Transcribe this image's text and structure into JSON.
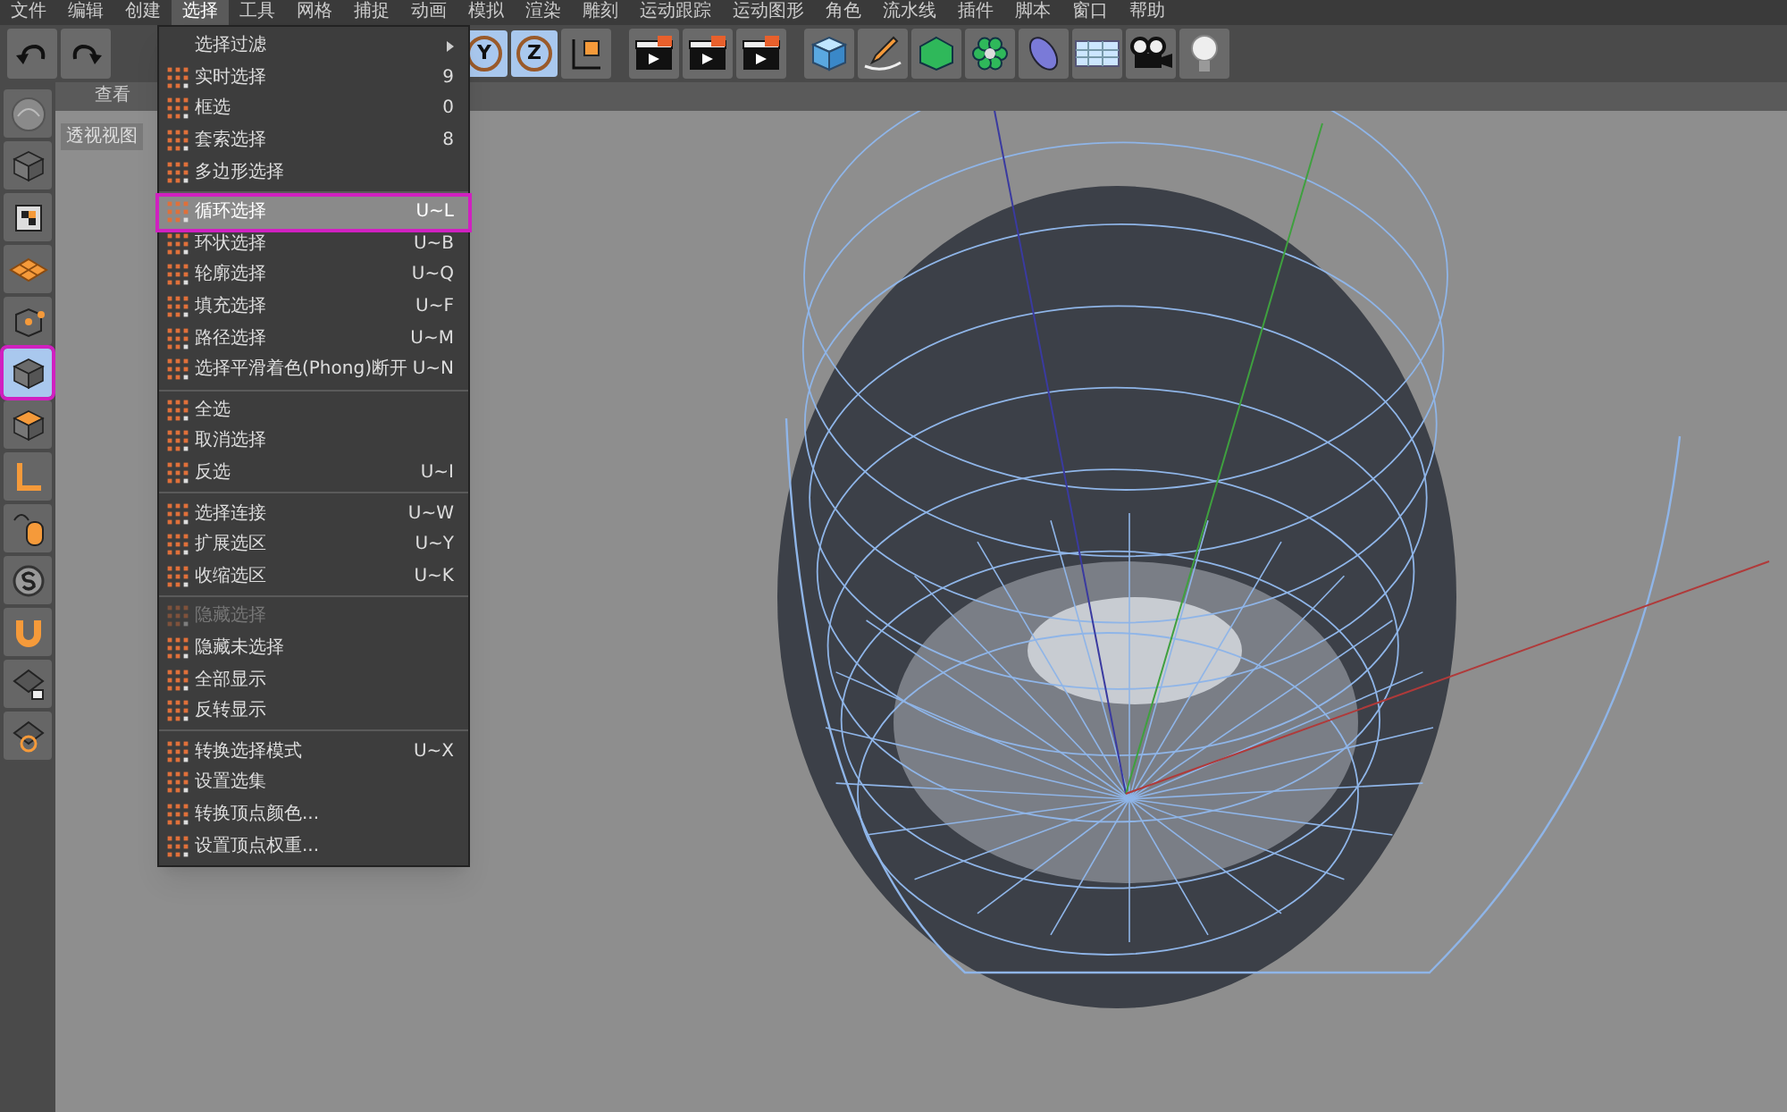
{
  "menubar": [
    {
      "label": "文件",
      "selected": false
    },
    {
      "label": "编辑",
      "selected": false
    },
    {
      "label": "创建",
      "selected": false
    },
    {
      "label": "选择",
      "selected": true
    },
    {
      "label": "工具",
      "selected": false
    },
    {
      "label": "网格",
      "selected": false
    },
    {
      "label": "捕捉",
      "selected": false
    },
    {
      "label": "动画",
      "selected": false
    },
    {
      "label": "模拟",
      "selected": false
    },
    {
      "label": "渲染",
      "selected": false
    },
    {
      "label": "雕刻",
      "selected": false
    },
    {
      "label": "运动跟踪",
      "selected": false
    },
    {
      "label": "运动图形",
      "selected": false
    },
    {
      "label": "角色",
      "selected": false
    },
    {
      "label": "流水线",
      "selected": false
    },
    {
      "label": "插件",
      "selected": false
    },
    {
      "label": "脚本",
      "selected": false
    },
    {
      "label": "窗口",
      "selected": false
    },
    {
      "label": "帮助",
      "selected": false
    }
  ],
  "toolbar": [
    {
      "kind": "undo"
    },
    {
      "kind": "redo"
    },
    {
      "kind": "wide_gap"
    },
    {
      "kind": "axis",
      "label": "Y"
    },
    {
      "kind": "axis",
      "label": "Z"
    },
    {
      "kind": "coords"
    },
    {
      "kind": "gap"
    },
    {
      "kind": "clapper"
    },
    {
      "kind": "clapper"
    },
    {
      "kind": "clapper"
    },
    {
      "kind": "gap"
    },
    {
      "kind": "cube"
    },
    {
      "kind": "pen"
    },
    {
      "kind": "gem"
    },
    {
      "kind": "flower"
    },
    {
      "kind": "capsule"
    },
    {
      "kind": "floor"
    },
    {
      "kind": "camera"
    },
    {
      "kind": "bulb"
    }
  ],
  "viewport": {
    "tabs": [
      "查看"
    ],
    "title": "透视视图"
  },
  "side_tools": [
    {
      "kind": "sculpt",
      "selected": false
    },
    {
      "kind": "cube",
      "selected": false
    },
    {
      "kind": "checker",
      "selected": false
    },
    {
      "kind": "plane",
      "selected": false
    },
    {
      "kind": "points",
      "selected": false
    },
    {
      "kind": "cube",
      "selected": true
    },
    {
      "kind": "topcube",
      "selected": false
    },
    {
      "kind": "corner",
      "selected": false
    },
    {
      "kind": "mouse",
      "selected": false
    },
    {
      "kind": "coin",
      "selected": false
    },
    {
      "kind": "magnet",
      "selected": false
    },
    {
      "kind": "lockgrid",
      "selected": false
    },
    {
      "kind": "gridring",
      "selected": false
    }
  ],
  "menu": {
    "groups": [
      [
        {
          "kind": "submenu",
          "label": "选择过滤",
          "selected": false,
          "disabled": false
        },
        {
          "kind": "command",
          "label": "实时选择",
          "shortcut": "9",
          "selected": false,
          "disabled": false
        },
        {
          "kind": "command",
          "label": "框选",
          "shortcut": "0",
          "selected": false,
          "disabled": false
        },
        {
          "kind": "command",
          "label": "套索选择",
          "shortcut": "8",
          "selected": false,
          "disabled": false
        },
        {
          "kind": "command",
          "label": "多边形选择",
          "selected": false,
          "disabled": false
        }
      ],
      [
        {
          "kind": "command",
          "label": "循环选择",
          "shortcut": "U~L",
          "selected": true,
          "disabled": false
        },
        {
          "kind": "command",
          "label": "环状选择",
          "shortcut": "U~B",
          "selected": false,
          "disabled": false
        },
        {
          "kind": "command",
          "label": "轮廓选择",
          "shortcut": "U~Q",
          "selected": false,
          "disabled": false
        },
        {
          "kind": "command",
          "label": "填充选择",
          "shortcut": "U~F",
          "selected": false,
          "disabled": false
        },
        {
          "kind": "command",
          "label": "路径选择",
          "shortcut": "U~M",
          "selected": false,
          "disabled": false
        },
        {
          "kind": "command",
          "label": "选择平滑着色(Phong)断开",
          "shortcut": "U~N",
          "selected": false,
          "disabled": false
        }
      ],
      [
        {
          "kind": "command",
          "label": "全选",
          "selected": false,
          "disabled": false
        },
        {
          "kind": "command",
          "label": "取消选择",
          "selected": false,
          "disabled": false
        },
        {
          "kind": "command",
          "label": "反选",
          "shortcut": "U~I",
          "selected": false,
          "disabled": false
        }
      ],
      [
        {
          "kind": "command",
          "label": "选择连接",
          "shortcut": "U~W",
          "selected": false,
          "disabled": false
        },
        {
          "kind": "command",
          "label": "扩展选区",
          "shortcut": "U~Y",
          "selected": false,
          "disabled": false
        },
        {
          "kind": "command",
          "label": "收缩选区",
          "shortcut": "U~K",
          "selected": false,
          "disabled": false
        }
      ],
      [
        {
          "kind": "command",
          "label": "隐藏选择",
          "selected": false,
          "disabled": true
        },
        {
          "kind": "command",
          "label": "隐藏未选择",
          "selected": false,
          "disabled": false
        },
        {
          "kind": "command",
          "label": "全部显示",
          "selected": false,
          "disabled": false
        },
        {
          "kind": "command",
          "label": "反转显示",
          "selected": false,
          "disabled": false
        }
      ],
      [
        {
          "kind": "command",
          "label": "转换选择模式",
          "shortcut": "U~X",
          "selected": false,
          "disabled": false
        },
        {
          "kind": "command",
          "label": "设置选集",
          "selected": false,
          "disabled": false
        },
        {
          "kind": "command",
          "label": "转换顶点颜色...",
          "selected": false,
          "disabled": false
        },
        {
          "kind": "command",
          "label": "设置顶点权重...",
          "selected": false,
          "disabled": false
        }
      ]
    ]
  }
}
